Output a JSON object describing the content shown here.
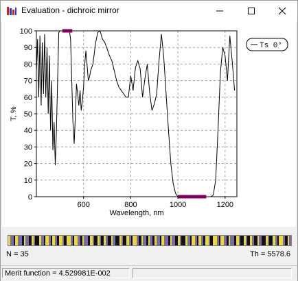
{
  "window": {
    "title": "Evaluation - dichroic mirror"
  },
  "chart_data": {
    "type": "line",
    "xlabel": "Wavelength, nm",
    "ylabel": "T, %",
    "xlim": [
      400,
      1250
    ],
    "ylim": [
      0,
      100
    ],
    "xticks": [
      600,
      800,
      1000,
      1200
    ],
    "yticks": [
      0,
      10,
      20,
      30,
      40,
      50,
      60,
      70,
      80,
      90,
      100
    ],
    "grid": true,
    "legend_position": "top-right",
    "series": [
      {
        "name": "Ts  0°",
        "color": "#000000",
        "x": [
          400,
          405,
          410,
          415,
          420,
          425,
          430,
          435,
          440,
          445,
          450,
          455,
          460,
          465,
          470,
          475,
          480,
          485,
          490,
          495,
          500,
          505,
          510,
          515,
          520,
          525,
          530,
          535,
          540,
          545,
          550,
          555,
          560,
          565,
          570,
          575,
          580,
          585,
          590,
          595,
          600,
          605,
          610,
          615,
          620,
          625,
          630,
          640,
          650,
          660,
          670,
          680,
          690,
          700,
          710,
          720,
          730,
          740,
          750,
          760,
          770,
          780,
          790,
          800,
          810,
          820,
          830,
          840,
          850,
          860,
          870,
          880,
          890,
          900,
          910,
          920,
          930,
          940,
          950,
          960,
          970,
          980,
          990,
          1000,
          1020,
          1040,
          1060,
          1080,
          1100,
          1120,
          1140,
          1150,
          1160,
          1170,
          1180,
          1190,
          1200,
          1210,
          1220,
          1230,
          1240
        ],
        "y": [
          75,
          95,
          60,
          97,
          55,
          93,
          62,
          98,
          60,
          90,
          50,
          85,
          40,
          70,
          28,
          45,
          19,
          40,
          70,
          99,
          100,
          100,
          100,
          100,
          100,
          100,
          100,
          100,
          100,
          95,
          70,
          45,
          32,
          48,
          68,
          62,
          55,
          64,
          52,
          58,
          66,
          80,
          88,
          79,
          70,
          72,
          76,
          80,
          92,
          99,
          100,
          95,
          93,
          89,
          85,
          82,
          76,
          70,
          66,
          64,
          62,
          60,
          60,
          73,
          64,
          78,
          82,
          77,
          60,
          71,
          80,
          63,
          52,
          56,
          62,
          82,
          98,
          84,
          62,
          40,
          20,
          8,
          2,
          0,
          0,
          0,
          0,
          0,
          0,
          0,
          0,
          1,
          10,
          40,
          75,
          90,
          85,
          70,
          97,
          82,
          64
        ]
      }
    ],
    "markers": [
      {
        "from": 510,
        "to": 552,
        "at": 100,
        "color": "#800060"
      },
      {
        "from": 1000,
        "to": 1120,
        "at": 0,
        "color": "#800060"
      }
    ]
  },
  "status": {
    "n_label": "N = 35",
    "th_label": "Th = 5578.6",
    "merit_label": "Merit function =  4.529981E-002"
  }
}
